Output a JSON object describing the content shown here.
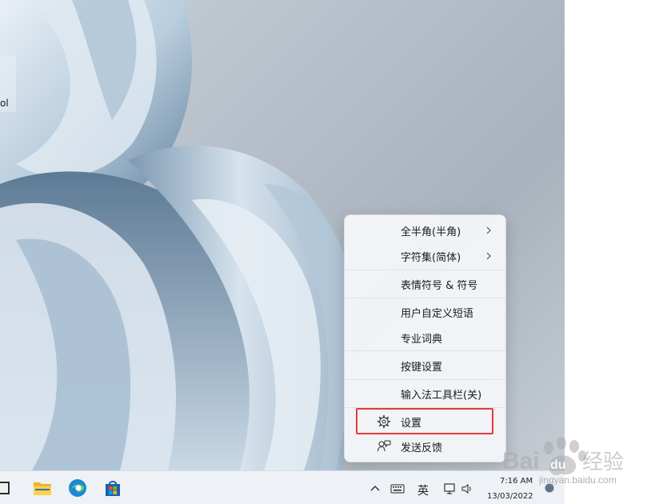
{
  "desktop": {
    "icon_label": "ol"
  },
  "menu": {
    "items": [
      {
        "label": "全半角(半角)",
        "has_submenu": true
      },
      {
        "label": "字符集(简体)",
        "has_submenu": true
      },
      {
        "label": "表情符号 & 符号"
      },
      {
        "label": "用户自定义短语"
      },
      {
        "label": "专业词典"
      },
      {
        "label": "按键设置"
      },
      {
        "label": "输入法工具栏(关)"
      },
      {
        "label": "设置",
        "icon": "gear-icon"
      },
      {
        "label": "发送反馈",
        "icon": "feedback-icon"
      }
    ],
    "highlight_color": "#e23a3a"
  },
  "taskbar": {
    "ime_label": "英",
    "time": "7:16 AM",
    "date": "13/03/2022"
  },
  "watermark": {
    "url": "jingyan.baidu.com"
  }
}
